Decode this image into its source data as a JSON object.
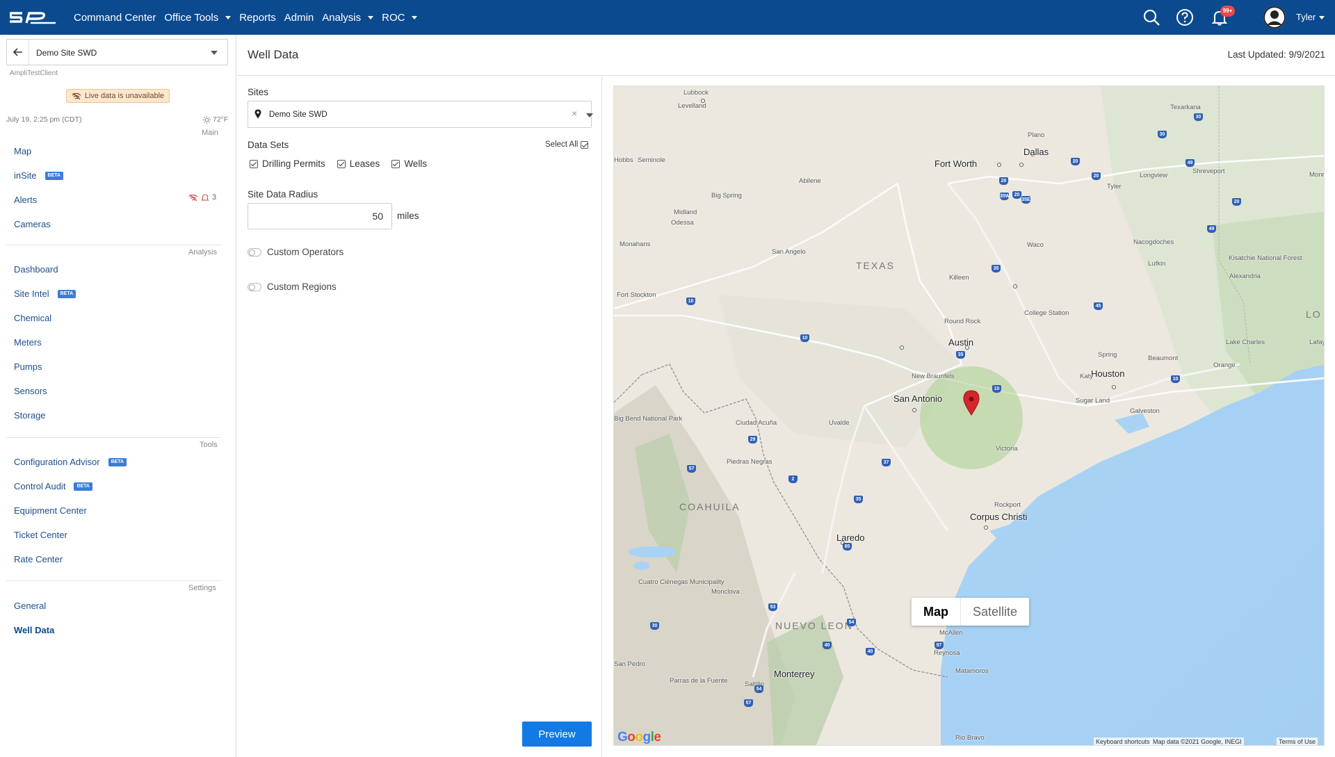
{
  "nav": {
    "items": [
      {
        "label": "Command Center",
        "caret": false
      },
      {
        "label": "Office Tools",
        "caret": true
      },
      {
        "label": "Reports",
        "caret": false
      },
      {
        "label": "Admin",
        "caret": false
      },
      {
        "label": "Analysis",
        "caret": true
      },
      {
        "label": "ROC",
        "caret": true
      }
    ],
    "notification_badge": "99+",
    "user_name": "Tyler",
    "icons": [
      "search-icon",
      "help-icon",
      "bell-icon",
      "user-avatar-icon"
    ]
  },
  "sidebar": {
    "site_name": "Demo Site SWD",
    "client_name": "AmpliTestClient",
    "live_status": "Live data is unavailable",
    "date": "July 19, 2:25 pm (CDT)",
    "temperature": "72°F",
    "sections": {
      "main": "Main",
      "analysis": "Analysis",
      "tools": "Tools",
      "settings": "Settings"
    },
    "main_items": [
      {
        "label": "Map",
        "beta": ""
      },
      {
        "label": "inSite",
        "beta": "BETA"
      },
      {
        "label": "Alerts",
        "beta": ""
      },
      {
        "label": "Cameras",
        "beta": ""
      }
    ],
    "alerts_count": "3",
    "analysis_items": [
      {
        "label": "Dashboard",
        "beta": ""
      },
      {
        "label": "Site Intel",
        "beta": "BETA"
      },
      {
        "label": "Chemical",
        "beta": ""
      },
      {
        "label": "Meters",
        "beta": ""
      },
      {
        "label": "Pumps",
        "beta": ""
      },
      {
        "label": "Sensors",
        "beta": ""
      },
      {
        "label": "Storage",
        "beta": ""
      }
    ],
    "tools_items": [
      {
        "label": "Configuration Advisor",
        "beta": "BETA"
      },
      {
        "label": "Control Audit",
        "beta": "BETA"
      },
      {
        "label": "Equipment Center",
        "beta": ""
      },
      {
        "label": "Ticket Center",
        "beta": ""
      },
      {
        "label": "Rate Center",
        "beta": ""
      }
    ],
    "settings_items": [
      {
        "label": "General",
        "beta": ""
      },
      {
        "label": "Well Data",
        "beta": ""
      }
    ]
  },
  "page": {
    "title": "Well Data",
    "last_updated": "Last Updated: 9/9/2021"
  },
  "form": {
    "sites_label": "Sites",
    "sites_value": "Demo Site SWD",
    "data_sets_label": "Data Sets",
    "select_all_label": "Select All",
    "data_sets": [
      {
        "label": "Drilling Permits",
        "checked": true
      },
      {
        "label": "Leases",
        "checked": true
      },
      {
        "label": "Wells",
        "checked": true
      }
    ],
    "radius_label": "Site Data Radius",
    "radius_value": "50",
    "radius_unit": "miles",
    "custom_operators_label": "Custom Operators",
    "custom_regions_label": "Custom Regions",
    "preview_label": "Preview"
  },
  "map": {
    "map_type_buttons": [
      "Map",
      "Satellite"
    ],
    "selected_type": "Map",
    "google_logo": "Google",
    "attribution": {
      "shortcuts": "Keyboard shortcuts",
      "data": "Map data ©2021 Google, INEGI",
      "terms": "Terms of Use"
    },
    "regions": [
      "TEXAS",
      "COAHUILA",
      "NUEVO LEON",
      "LO"
    ],
    "cities_major": [
      "Fort Worth",
      "Dallas",
      "Austin",
      "San Antonio",
      "Houston",
      "Corpus Christi",
      "Laredo",
      "Monterrey"
    ],
    "cities_minor": [
      "Lubbock",
      "Levelland",
      "Plano",
      "Texarkana",
      "Hobbs",
      "Seminole",
      "Abilene",
      "Tyler",
      "Longview",
      "Shreveport",
      "Monroe",
      "Big Spring",
      "Midland",
      "Odessa",
      "Waco",
      "Monahans",
      "San Angelo",
      "Nacogdoches",
      "Lufkin",
      "Kisatchie National Forest",
      "Alexandria",
      "Killeen",
      "Fort Stockton",
      "College Station",
      "Round Rock",
      "Lake Charles",
      "Lafayette",
      "Spring",
      "Beaumont",
      "Orange",
      "Katy",
      "Sugar Land",
      "Galveston",
      "New Braunfels",
      "Big Bend National Park",
      "Ciudad Acuña",
      "Uvalde",
      "Victoria",
      "Piedras Negras",
      "Rockport",
      "Cuatro Ciénegas Municipality",
      "Monclova",
      "McAllen",
      "Reynosa",
      "Matamoros",
      "San Pedro",
      "Parras de la Fuente",
      "Saltillo",
      "Rio Bravo"
    ],
    "highways": [
      "30",
      "30",
      "20",
      "49",
      "20",
      "20",
      "35W",
      "35E",
      "20",
      "20",
      "49",
      "35",
      "10",
      "10",
      "45",
      "35",
      "10",
      "29",
      "57",
      "37",
      "35",
      "2",
      "85",
      "53",
      "54",
      "30",
      "40",
      "40",
      "97",
      "57",
      "54",
      "10"
    ]
  }
}
